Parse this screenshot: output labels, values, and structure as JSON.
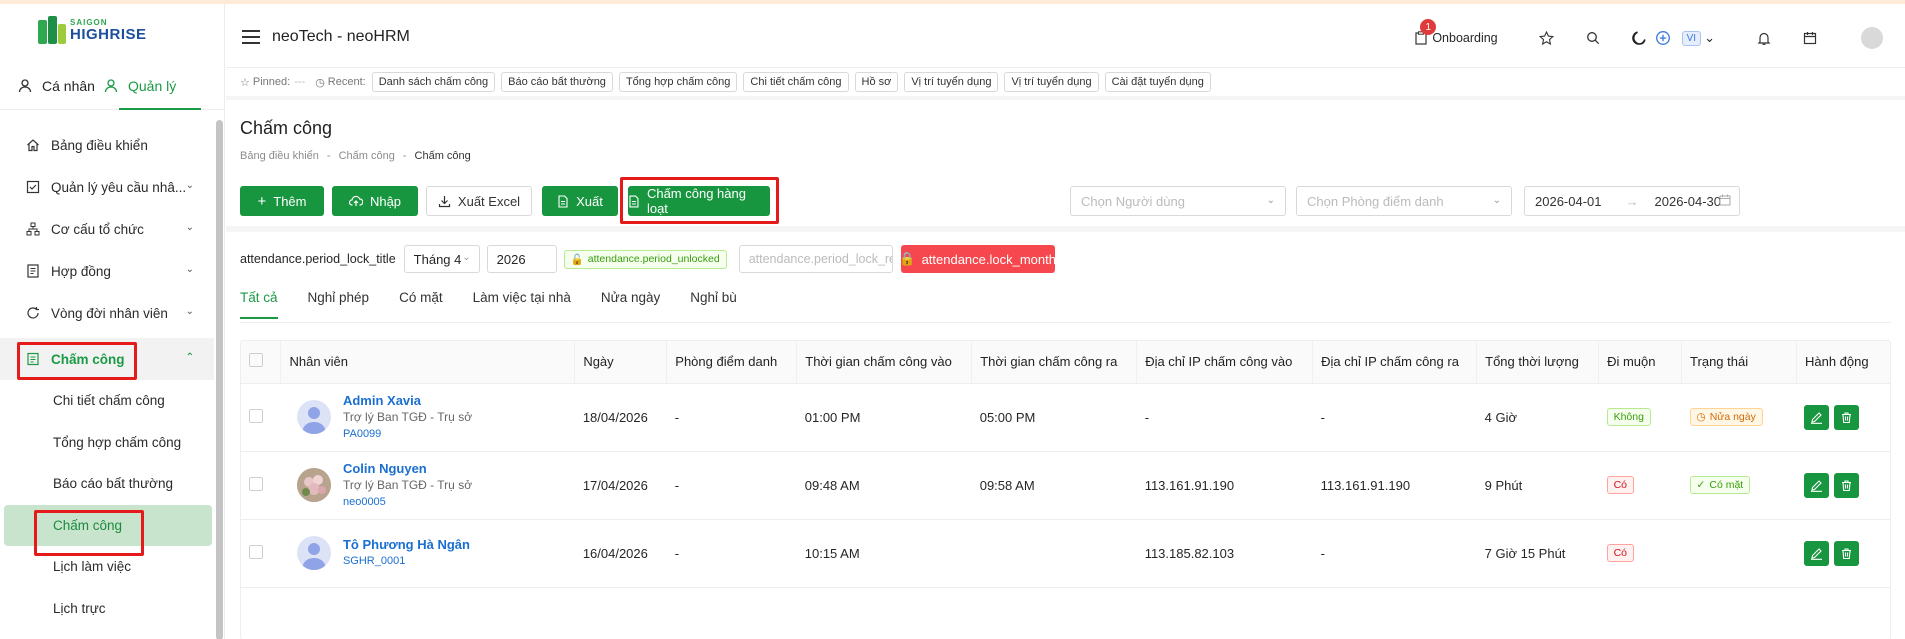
{
  "logo": {
    "line1": "SAIGON",
    "line2": "HIGHRISE"
  },
  "modes": {
    "personal": "Cá nhân",
    "manage": "Quản lý"
  },
  "sidebar": {
    "items": [
      {
        "label": "Bảng điều khiển",
        "icon": "home-icon"
      },
      {
        "label": "Quản lý yêu cầu nhâ...",
        "icon": "checkbox-icon"
      },
      {
        "label": "Cơ cấu tổ chức",
        "icon": "org-chart-icon"
      },
      {
        "label": "Hợp đồng",
        "icon": "contract-icon"
      },
      {
        "label": "Vòng đời nhân viên",
        "icon": "cycle-icon"
      },
      {
        "label": "Chấm công",
        "icon": "timesheet-icon"
      }
    ],
    "subitems": [
      "Chi tiết chấm công",
      "Tổng hợp chấm công",
      "Báo cáo bất thường",
      "Chấm công",
      "Lịch làm việc",
      "Lịch trực"
    ]
  },
  "header": {
    "title": "neoTech - neoHRM",
    "onboarding": "Onboarding",
    "badge": "1",
    "lang": "VI"
  },
  "recent": {
    "pinned_label": "Pinned:",
    "pinned_value": "---",
    "recent_label": "Recent:",
    "chips": [
      "Danh sách chấm công",
      "Báo cáo bất thường",
      "Tổng hợp chấm công",
      "Chi tiết chấm công",
      "Hồ sơ",
      "Vị trí tuyển dụng",
      "Vị trí tuyển dụng",
      "Cài đặt tuyển dụng"
    ]
  },
  "page": {
    "title": "Chấm công",
    "breadcrumb": [
      "Bảng điều khiển",
      "-",
      "Chấm công",
      "-",
      "Chấm công"
    ]
  },
  "toolbar": {
    "add": "Thêm",
    "import": "Nhập",
    "export_excel": "Xuất Excel",
    "export": "Xuất",
    "bulk": "Chấm công hàng loạt",
    "user_placeholder": "Chọn Người dùng",
    "room_placeholder": "Chọn Phòng điểm danh",
    "date_from": "2026-04-01",
    "date_to": "2026-04-30"
  },
  "lock": {
    "title": "attendance.period_lock_title",
    "month": "Tháng 4",
    "year": "2026",
    "status": "attendance.period_unlocked",
    "reason_placeholder": "attendance.period_lock_re...",
    "lock_button": "attendance.lock_month"
  },
  "tabs": [
    "Tất cả",
    "Nghỉ phép",
    "Có mặt",
    "Làm việc tại nhà",
    "Nửa ngày",
    "Nghỉ bù"
  ],
  "table": {
    "headers": [
      "Nhân viên",
      "Ngày",
      "Phòng điểm danh",
      "Thời gian chấm công vào",
      "Thời gian chấm công ra",
      "Địa chỉ IP chấm công vào",
      "Địa chỉ IP chấm công ra",
      "Tổng thời lượng",
      "Đi muộn",
      "Trạng thái",
      "Hành động"
    ],
    "rows": [
      {
        "name": "Admin Xavia",
        "position": "Trợ lý Ban TGĐ - Trụ sở",
        "code": "PA0099",
        "date": "18/04/2026",
        "room": "-",
        "in": "01:00 PM",
        "out": "05:00 PM",
        "ip_in": "-",
        "ip_out": "-",
        "duration": "4 Giờ",
        "late": "Không",
        "status": "Nửa ngày"
      },
      {
        "name": "Colin Nguyen",
        "position": "Trợ lý Ban TGĐ - Trụ sở",
        "code": "neo0005",
        "date": "17/04/2026",
        "room": "-",
        "in": "09:48 AM",
        "out": "09:58 AM",
        "ip_in": "113.161.91.190",
        "ip_out": "113.161.91.190",
        "duration": "9 Phút",
        "late": "Có",
        "status": "Có mặt"
      },
      {
        "name": "Tô Phương Hà Ngân",
        "position": "",
        "code": "SGHR_0001",
        "date": "16/04/2026",
        "room": "-",
        "in": "10:15 AM",
        "out": "",
        "ip_in": "113.185.82.103",
        "ip_out": "-",
        "duration": "7 Giờ 15 Phút",
        "late": "Có",
        "status": ""
      }
    ]
  },
  "colors": {
    "primary": "#18963f",
    "danger": "#f5474d",
    "highlight": "#e51a1a"
  }
}
